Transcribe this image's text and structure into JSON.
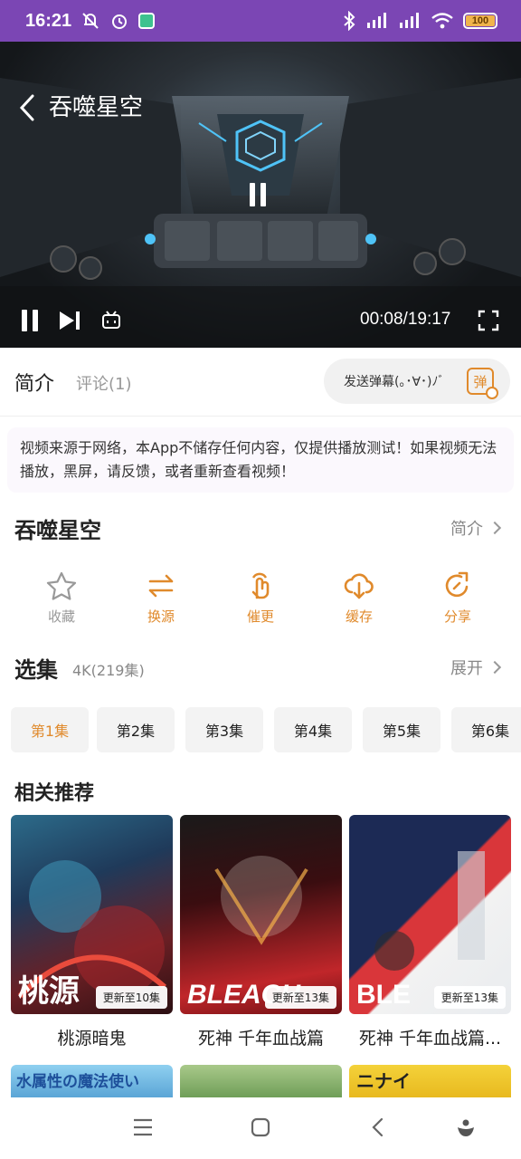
{
  "status": {
    "time": "16:21",
    "battery": "100",
    "colors": {
      "bar": "#7b46b4"
    }
  },
  "player": {
    "title": "吞噬星空",
    "time_display": "00:08/19:17"
  },
  "tabs": {
    "intro": "简介",
    "comments": "评论(1)"
  },
  "danmaku": {
    "placeholder": "发送弹幕(｡･∀･)ﾉﾞ",
    "icon_label": "弹"
  },
  "notice": "视频来源于网络，本App不储存任何内容，仅提供播放测试！如果视频无法播放，黑屏，请反馈，或者重新查看视频！",
  "info": {
    "title": "吞噬星空",
    "intro_link": "简介"
  },
  "actions": [
    {
      "label": "收藏",
      "icon": "star-icon",
      "color": "#999999"
    },
    {
      "label": "换源",
      "icon": "swap-icon",
      "color": "#e08a2c"
    },
    {
      "label": "催更",
      "icon": "hand-icon",
      "color": "#e08a2c"
    },
    {
      "label": "缓存",
      "icon": "cloud-download-icon",
      "color": "#e08a2c"
    },
    {
      "label": "分享",
      "icon": "share-icon",
      "color": "#e08a2c"
    }
  ],
  "episodes": {
    "title": "选集",
    "meta": "4K(219集)",
    "expand": "展开",
    "items": [
      "第1集",
      "第2集",
      "第3集",
      "第4集",
      "第5集",
      "第6集"
    ]
  },
  "recommend": {
    "title": "相关推荐",
    "items": [
      {
        "name": "桃源暗鬼",
        "badge": "更新至10集",
        "poster_text": "桃源"
      },
      {
        "name": "死神 千年血战篇",
        "badge": "更新至13集",
        "poster_text": "BLEACH"
      },
      {
        "name": "死神 千年血战篇...",
        "badge": "更新至13集",
        "poster_text": "BLE"
      }
    ],
    "row2_text": [
      "水属性の魔法使い",
      "",
      "ニナイ"
    ]
  }
}
